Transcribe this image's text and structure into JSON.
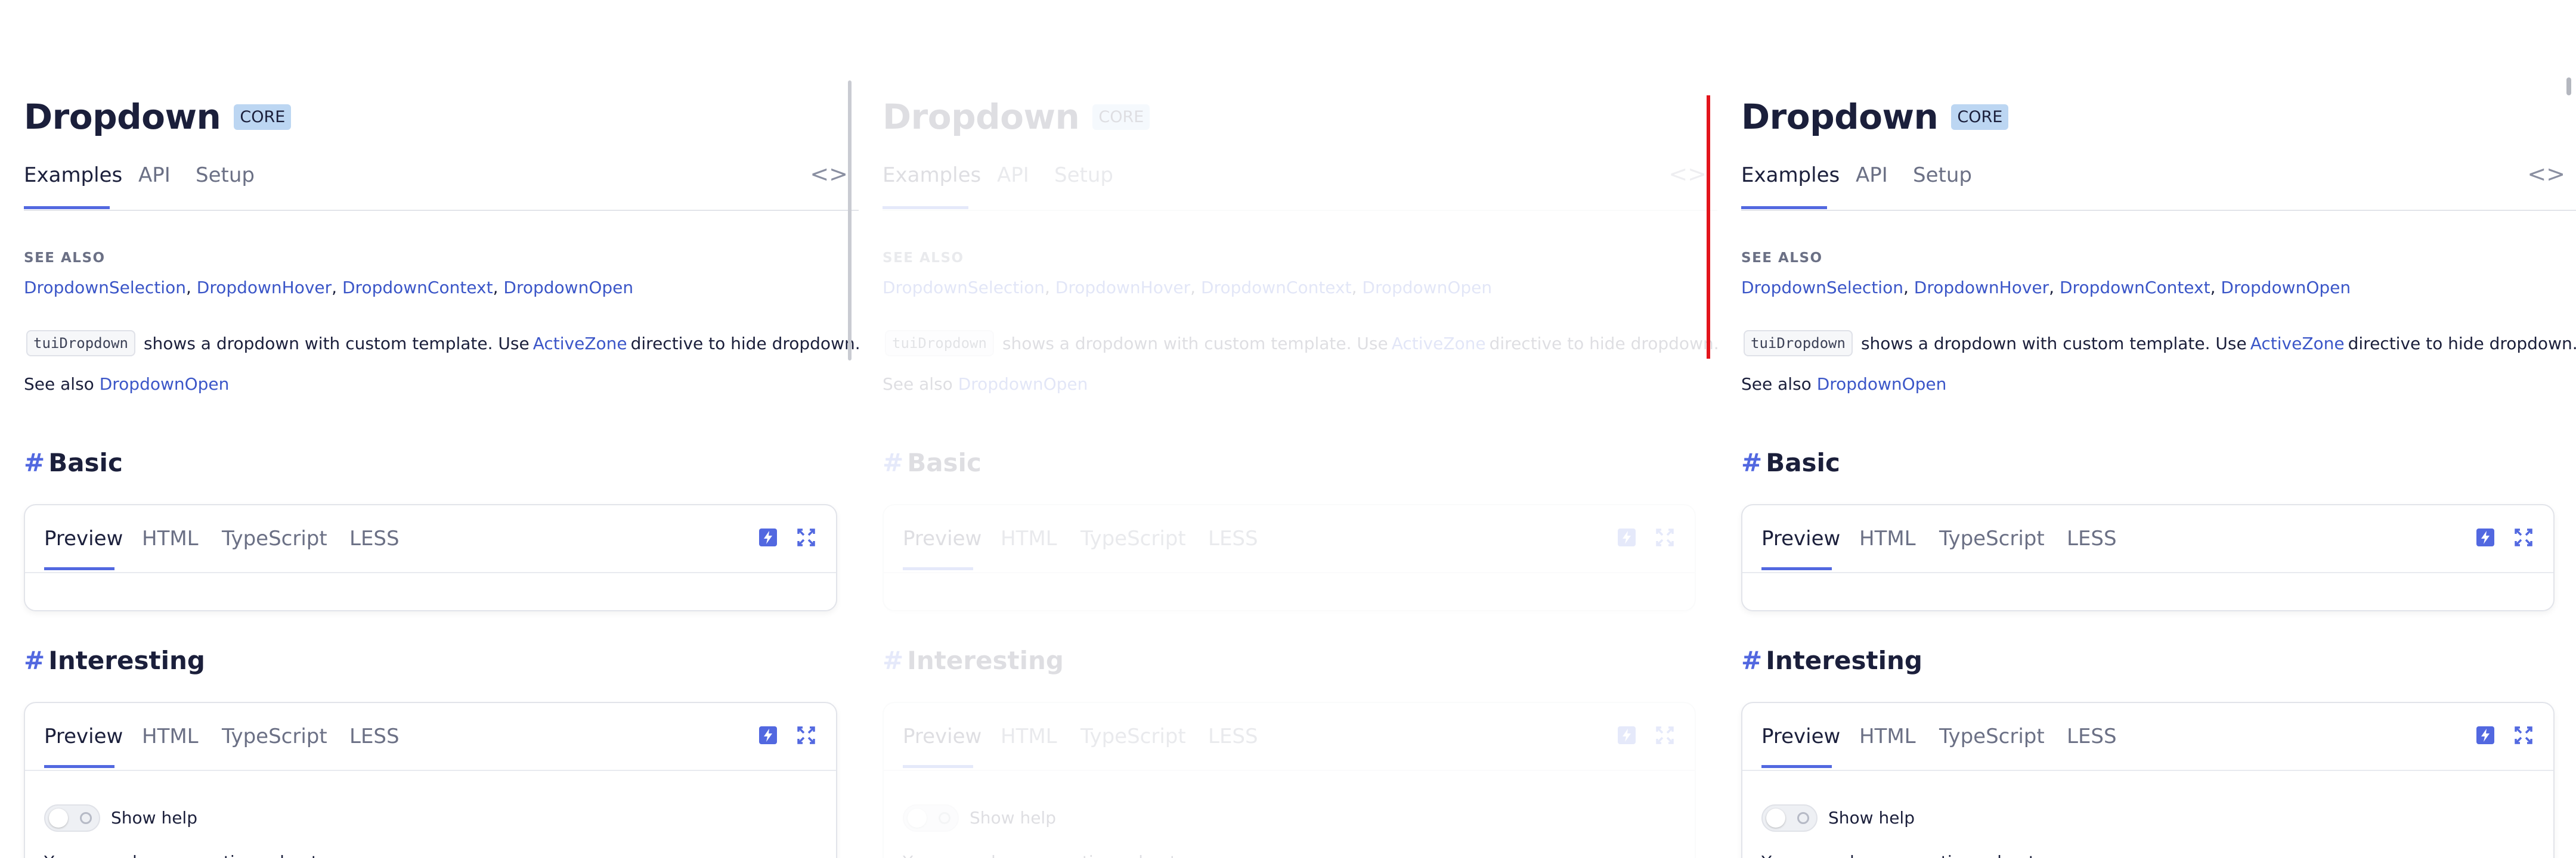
{
  "page": {
    "title": "Dropdown",
    "badge": "CORE",
    "tabs": [
      "Examples",
      "API",
      "Setup"
    ],
    "code_toggle_icon": "code-brackets-icon"
  },
  "see_also": {
    "heading": "SEE ALSO",
    "links": [
      "DropdownSelection",
      "DropdownHover",
      "DropdownContext",
      "DropdownOpen"
    ],
    "separator": ", "
  },
  "description": {
    "chip": "tuiDropdown",
    "text_before": "shows a dropdown with custom template. Use",
    "link": "ActiveZone",
    "text_after": "directive to hide dropdown."
  },
  "see_also_line": {
    "prefix": "See also",
    "link": "DropdownOpen"
  },
  "sections": [
    {
      "hash": "#",
      "title": "Basic",
      "tabs": [
        "Preview",
        "HTML",
        "TypeScript",
        "LESS"
      ]
    },
    {
      "hash": "#",
      "title": "Interesting",
      "tabs": [
        "Preview",
        "HTML",
        "TypeScript",
        "LESS"
      ],
      "toggle_label": "Show help",
      "partial_text": "You can ask any questions about"
    }
  ],
  "colors": {
    "accent": "#5268e0",
    "link": "#3b56c8",
    "badge_bg": "#bcd6f2",
    "divider_red": "#e3141b"
  }
}
